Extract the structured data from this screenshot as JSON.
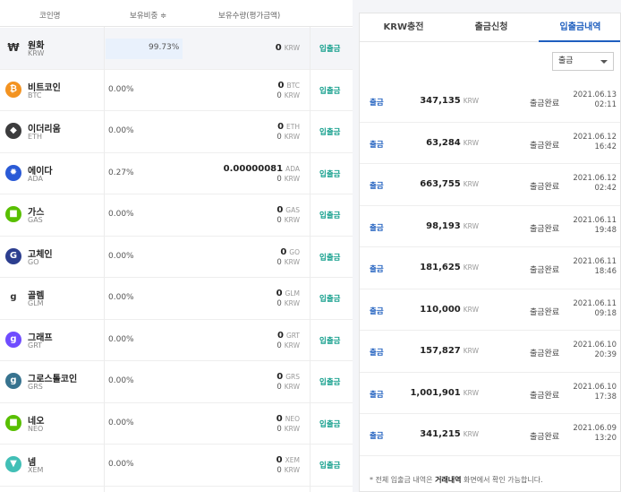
{
  "left_header": {
    "coin_name": "코인명",
    "ratio": "보유비중 ≑",
    "amount": "보유수량(평가금액)"
  },
  "coins": [
    {
      "name": "원화",
      "symbol": "KRW",
      "icon": "won-icon",
      "color": "#ffffff",
      "pct": "99.73%",
      "amt": "0",
      "amt_unit": "KRW",
      "krw": "",
      "krw_unit": "",
      "btn": "입출금"
    },
    {
      "name": "비트코인",
      "symbol": "BTC",
      "icon": "bitcoin-icon",
      "color": "#f39321",
      "pct": "0.00%",
      "amt": "0",
      "amt_unit": "BTC",
      "krw": "0",
      "krw_unit": "KRW",
      "btn": "입출금"
    },
    {
      "name": "이더리움",
      "symbol": "ETH",
      "icon": "ethereum-icon",
      "color": "#3c3c3d",
      "pct": "0.00%",
      "amt": "0",
      "amt_unit": "ETH",
      "krw": "0",
      "krw_unit": "KRW",
      "btn": "입출금"
    },
    {
      "name": "에이다",
      "symbol": "ADA",
      "icon": "cardano-icon",
      "color": "#2a5ad6",
      "pct": "0.27%",
      "amt": "0.00000081",
      "amt_unit": "ADA",
      "krw": "0",
      "krw_unit": "KRW",
      "btn": "입출금"
    },
    {
      "name": "가스",
      "symbol": "GAS",
      "icon": "gas-icon",
      "color": "#58bf00",
      "pct": "0.00%",
      "amt": "0",
      "amt_unit": "GAS",
      "krw": "0",
      "krw_unit": "KRW",
      "btn": "입출금"
    },
    {
      "name": "고체인",
      "symbol": "GO",
      "icon": "gochain-icon",
      "color": "#2c3e8f",
      "pct": "0.00%",
      "amt": "0",
      "amt_unit": "GO",
      "krw": "0",
      "krw_unit": "KRW",
      "btn": "입출금"
    },
    {
      "name": "골렘",
      "symbol": "GLM",
      "icon": "golem-icon",
      "color": "#ffffff",
      "pct": "0.00%",
      "amt": "0",
      "amt_unit": "GLM",
      "krw": "0",
      "krw_unit": "KRW",
      "btn": "입출금"
    },
    {
      "name": "그래프",
      "symbol": "GRT",
      "icon": "graph-icon",
      "color": "#6f4cff",
      "pct": "0.00%",
      "amt": "0",
      "amt_unit": "GRT",
      "krw": "0",
      "krw_unit": "KRW",
      "btn": "입출금"
    },
    {
      "name": "그로스톨코인",
      "symbol": "GRS",
      "icon": "groestlcoin-icon",
      "color": "#37738f",
      "pct": "0.00%",
      "amt": "0",
      "amt_unit": "GRS",
      "krw": "0",
      "krw_unit": "KRW",
      "btn": "입출금"
    },
    {
      "name": "네오",
      "symbol": "NEO",
      "icon": "neo-icon",
      "color": "#58bf00",
      "pct": "0.00%",
      "amt": "0",
      "amt_unit": "NEO",
      "krw": "0",
      "krw_unit": "KRW",
      "btn": "입출금"
    },
    {
      "name": "넴",
      "symbol": "XEM",
      "icon": "nem-icon",
      "color": "#41bfb6",
      "pct": "0.00%",
      "amt": "0",
      "amt_unit": "XEM",
      "krw": "0",
      "krw_unit": "KRW",
      "btn": "입출금"
    }
  ],
  "tabs": [
    "KRW충전",
    "출금신청",
    "입출금내역"
  ],
  "filter": {
    "selected": "출금"
  },
  "history": [
    {
      "type": "출금",
      "amount": "347,135",
      "unit": "KRW",
      "status": "출금완료",
      "date": "2021.06.13",
      "time": "02:11"
    },
    {
      "type": "출금",
      "amount": "63,284",
      "unit": "KRW",
      "status": "출금완료",
      "date": "2021.06.12",
      "time": "16:42"
    },
    {
      "type": "출금",
      "amount": "663,755",
      "unit": "KRW",
      "status": "출금완료",
      "date": "2021.06.12",
      "time": "02:42"
    },
    {
      "type": "출금",
      "amount": "98,193",
      "unit": "KRW",
      "status": "출금완료",
      "date": "2021.06.11",
      "time": "19:48"
    },
    {
      "type": "출금",
      "amount": "181,625",
      "unit": "KRW",
      "status": "출금완료",
      "date": "2021.06.11",
      "time": "18:46"
    },
    {
      "type": "출금",
      "amount": "110,000",
      "unit": "KRW",
      "status": "출금완료",
      "date": "2021.06.11",
      "time": "09:18"
    },
    {
      "type": "출금",
      "amount": "157,827",
      "unit": "KRW",
      "status": "출금완료",
      "date": "2021.06.10",
      "time": "20:39"
    },
    {
      "type": "출금",
      "amount": "1,001,901",
      "unit": "KRW",
      "status": "출금완료",
      "date": "2021.06.10",
      "time": "17:38"
    },
    {
      "type": "출금",
      "amount": "341,215",
      "unit": "KRW",
      "status": "출금완료",
      "date": "2021.06.09",
      "time": "13:20"
    }
  ],
  "note": {
    "pre": "* 전체 입출금 내역은 ",
    "bold": "거래내역",
    "post": " 화면에서 확인 가능합니다."
  }
}
